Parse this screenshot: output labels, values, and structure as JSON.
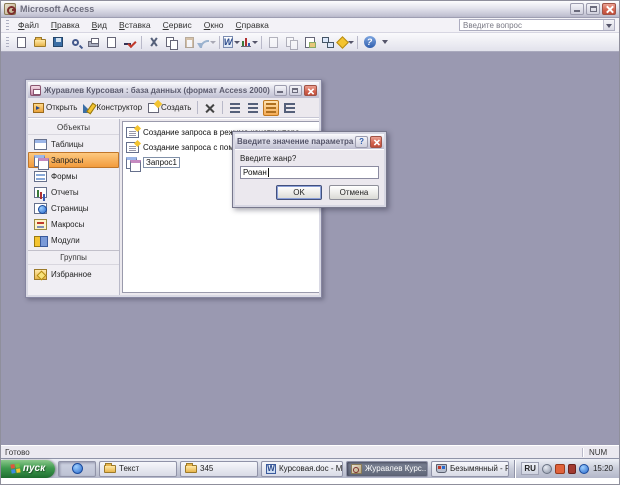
{
  "app": {
    "title": "Microsoft Access",
    "menu": {
      "items": [
        "Файл",
        "Правка",
        "Вид",
        "Вставка",
        "Сервис",
        "Окно",
        "Справка"
      ]
    },
    "ask": "Введите вопрос"
  },
  "icons": {
    "officelinks_glyph": "W",
    "help_glyph": "?",
    "word_glyph": "W"
  },
  "db": {
    "title": "Журавлев Курсовая : база данных (формат Access 2000)",
    "toolbar": {
      "open": "Открыть",
      "design": "Конструктор",
      "create": "Создать"
    },
    "objects_header": "Объекты",
    "objects": [
      "Таблицы",
      "Запросы",
      "Формы",
      "Отчеты",
      "Страницы",
      "Макросы",
      "Модули"
    ],
    "groups_header": "Группы",
    "groups": [
      "Избранное"
    ],
    "list": [
      "Создание запроса в режиме конструктора",
      "Создание запроса с помощью мастера",
      "Запрос1"
    ]
  },
  "dialog": {
    "title": "Введите значение параметра",
    "prompt": "Введите жанр?",
    "value": "Роман",
    "ok": "OK",
    "cancel": "Отмена"
  },
  "status": {
    "ready": "Готово",
    "num": "NUM"
  },
  "taskbar": {
    "start": "пуск",
    "tasks": [
      "Текст",
      "345",
      "Курсовая.doc - M...",
      "Журавлев Курс...",
      "Безымянный - Paint"
    ],
    "lang": "RU",
    "time": "15:20"
  },
  "colors": {
    "mdi_bg": "#9a99b1",
    "selected_orange": "#f29b3d",
    "close_red": "#d2604c",
    "start_green": "#2f8840"
  }
}
